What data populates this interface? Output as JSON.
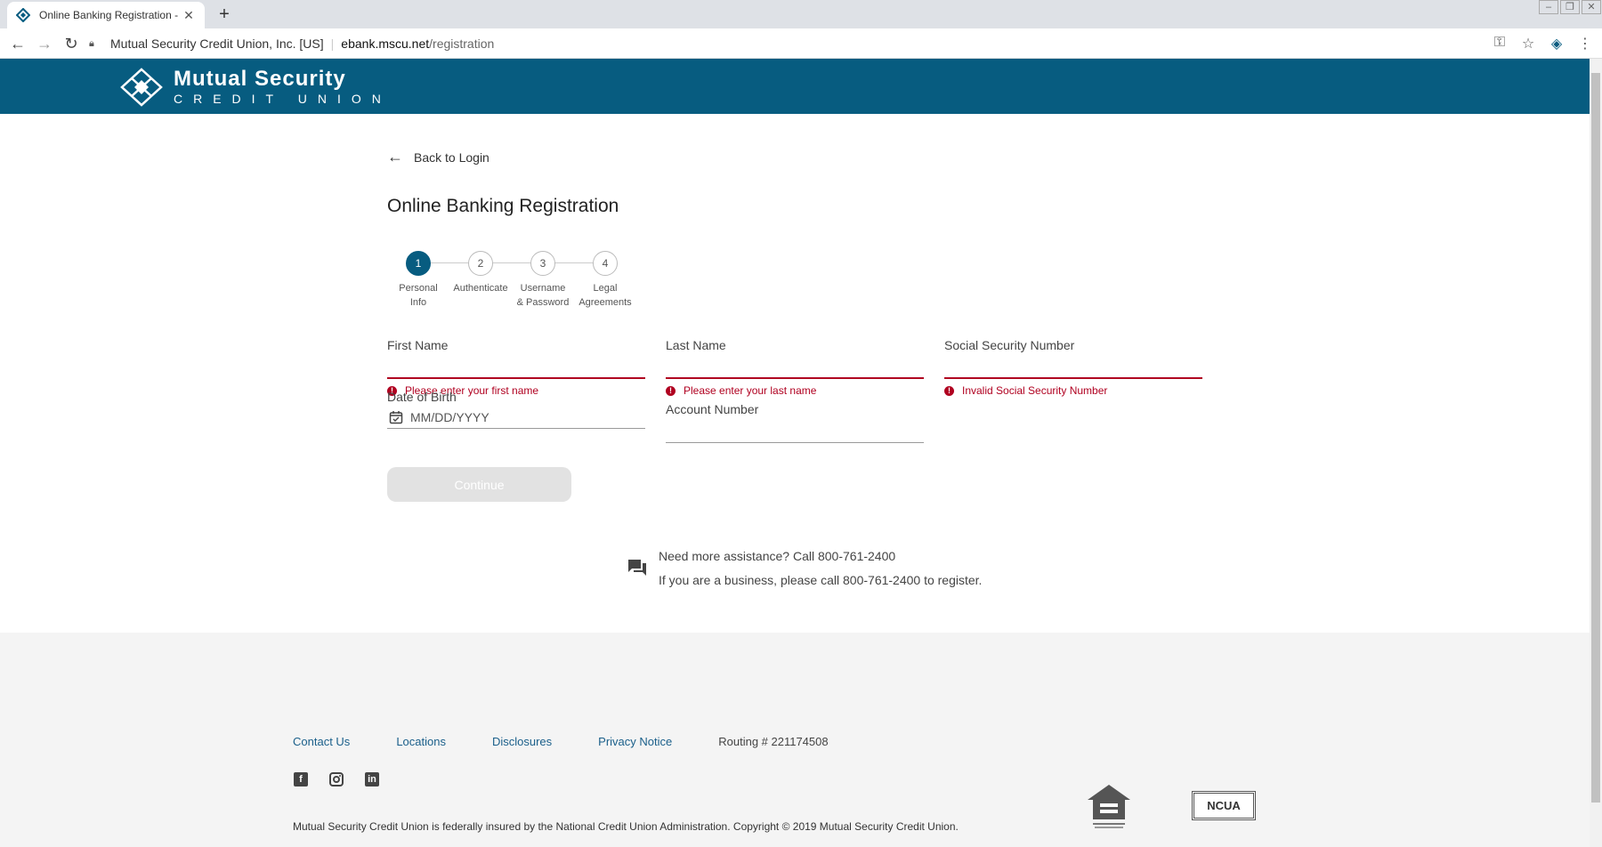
{
  "browser": {
    "tab_title": "Online Banking Registration - MSCU",
    "tab_close": "✕",
    "new_tab": "+",
    "address": {
      "org": "Mutual Security Credit Union, Inc. [US]",
      "host": "ebank.mscu.net",
      "path": "/registration"
    }
  },
  "brand": {
    "line1": "Mutual Security",
    "line2": "CREDIT UNION",
    "header_color": "#075c80"
  },
  "nav": {
    "back_label": "Back to Login"
  },
  "page": {
    "title": "Online Banking Registration"
  },
  "stepper": {
    "active": 1,
    "steps": [
      {
        "num": "1",
        "line1": "Personal",
        "line2": "Info"
      },
      {
        "num": "2",
        "line1": "Authenticate",
        "line2": ""
      },
      {
        "num": "3",
        "line1": "Username",
        "line2": "& Password"
      },
      {
        "num": "4",
        "line1": "Legal",
        "line2": "Agreements"
      }
    ]
  },
  "form": {
    "first_name": {
      "label": "First Name",
      "value": "",
      "error": "Please enter your first name"
    },
    "last_name": {
      "label": "Last Name",
      "value": "",
      "error": "Please enter your last name"
    },
    "ssn": {
      "label": "Social Security Number",
      "value": "",
      "error": "Invalid Social Security Number"
    },
    "dob": {
      "label": "Date of Birth",
      "placeholder": "MM/DD/YYYY"
    },
    "account": {
      "label": "Account Number",
      "value": ""
    },
    "continue_label": "Continue",
    "error_color": "#b00020"
  },
  "assistance": {
    "line1": "Need more assistance? Call 800-761-2400",
    "line2": "If you are a business, please call 800-761-2400 to register."
  },
  "footer": {
    "links": [
      "Contact Us",
      "Locations",
      "Disclosures",
      "Privacy Notice"
    ],
    "routing": "Routing # 221174508",
    "socials": [
      "facebook-icon",
      "instagram-icon",
      "linkedin-icon"
    ],
    "legal": "Mutual Security Credit Union is federally insured by the National Credit Union Administration. Copyright © 2019 Mutual Security Credit Union.",
    "ncua_label": "NCUA"
  }
}
